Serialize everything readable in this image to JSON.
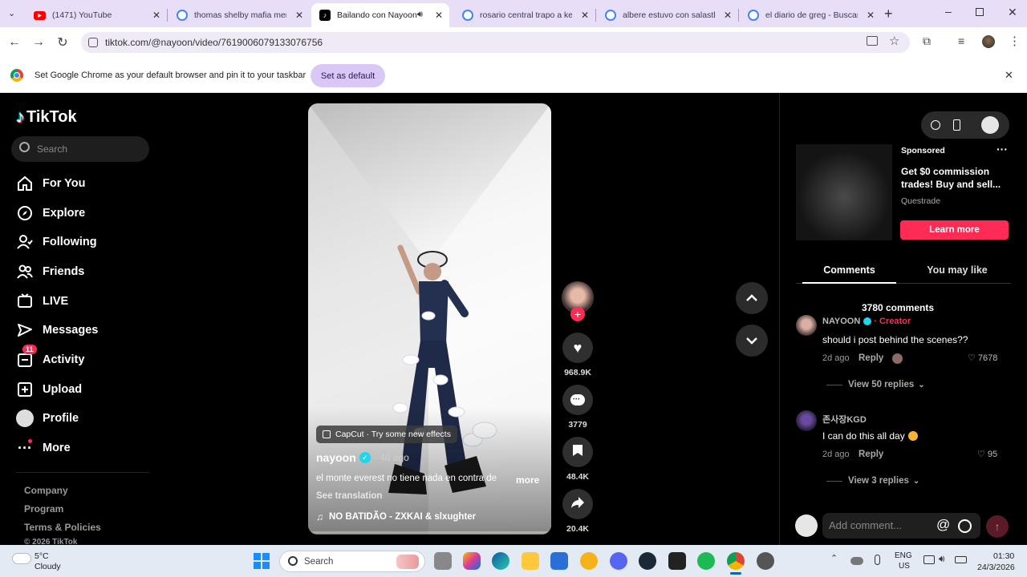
{
  "colors": {
    "tabstrip": "#e8def8",
    "tiktok_red": "#fe2c55",
    "verified": "#20d5ec",
    "taskbar": "#e3eaf4"
  },
  "browser": {
    "tabs": [
      {
        "title": "(1471) YouTube",
        "icon": "youtube-icon"
      },
      {
        "title": "thomas shelby mafia mem",
        "icon": "google-icon"
      },
      {
        "title": "Bailando con Nayoon",
        "icon": "tiktok-icon",
        "active": true
      },
      {
        "title": "rosario central trapo a key",
        "icon": "google-icon"
      },
      {
        "title": "albere estuvo con salastkb",
        "icon": "google-icon"
      },
      {
        "title": "el diario de greg - Buscar c",
        "icon": "google-icon"
      }
    ],
    "url": "tiktok.com/@nayoon/video/7619006079133076756",
    "infobar": {
      "message": "Set Google Chrome as your default browser and pin it to your taskbar",
      "button": "Set as default"
    }
  },
  "tiktok": {
    "logo": "TikTok",
    "search_placeholder": "Search",
    "nav": [
      {
        "label": "For You",
        "icon": "home-icon"
      },
      {
        "label": "Explore",
        "icon": "compass-icon"
      },
      {
        "label": "Following",
        "icon": "following-icon"
      },
      {
        "label": "Friends",
        "icon": "friends-icon"
      },
      {
        "label": "LIVE",
        "icon": "live-icon"
      },
      {
        "label": "Messages",
        "icon": "messages-icon"
      },
      {
        "label": "Activity",
        "icon": "activity-icon",
        "badge": "11"
      },
      {
        "label": "Upload",
        "icon": "upload-icon"
      },
      {
        "label": "Profile",
        "icon": "profile-avatar"
      },
      {
        "label": "More",
        "icon": "more-icon"
      }
    ],
    "footer": [
      "Company",
      "Program",
      "Terms & Policies",
      "© 2026 TikTok"
    ],
    "video": {
      "effect_label": "CapCut · Try some new effects",
      "author": "nayoon",
      "time": "· 4d ago",
      "caption": "el monte everest no tiene nada en contra de",
      "more": "more",
      "see_translation": "See translation",
      "music": "NO BATIDÃO - ZXKAI & slxughter"
    },
    "actions": {
      "likes": "968.9K",
      "comments": "3779",
      "saves": "48.4K",
      "shares": "20.4K"
    },
    "ad": {
      "sponsored": "Sponsored",
      "title": "Get $0 commission trades! Buy and sell...",
      "advertiser": "Questrade",
      "cta": "Learn more"
    },
    "panel_tabs": [
      "Comments",
      "You may like"
    ],
    "comment_count": "3780 comments",
    "comments": [
      {
        "user": "NAYOON",
        "creator": "· Creator",
        "text": "should i post behind the scenes??",
        "time": "2d ago",
        "reply": "Reply",
        "likes": "7678",
        "view_replies": "View 50 replies"
      },
      {
        "user": "존사장KGD",
        "text": "I can do this all day",
        "time": "2d ago",
        "reply": "Reply",
        "likes": "95",
        "view_replies": "View 3 replies"
      }
    ],
    "add_comment_placeholder": "Add comment..."
  },
  "taskbar": {
    "weather_temp": "5°C",
    "weather_desc": "Cloudy",
    "search_placeholder": "Search",
    "lang": "ENG",
    "region": "US",
    "time": "01:30",
    "date": "24/3/2026"
  }
}
